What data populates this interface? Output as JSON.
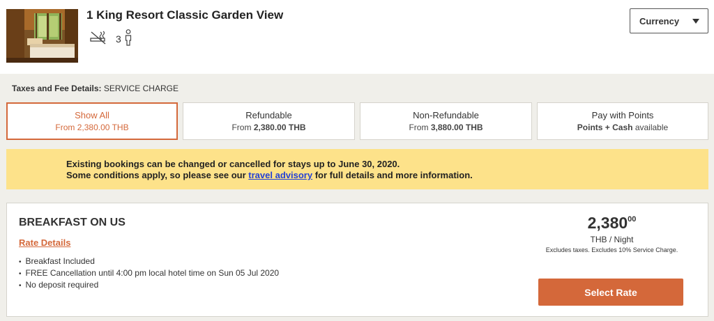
{
  "room": {
    "title": "1 King Resort Classic Garden View",
    "occupancy": "3",
    "icons": [
      "no-smoking-icon",
      "person-icon"
    ]
  },
  "currency": {
    "label": "Currency"
  },
  "taxes": {
    "label": "Taxes and Fee Details:",
    "value": "SERVICE CHARGE"
  },
  "tabs": [
    {
      "title": "Show All",
      "prefix": "From",
      "price": "2,380.00 THB",
      "active": true
    },
    {
      "title": "Refundable",
      "prefix": "From",
      "price": "2,380.00 THB"
    },
    {
      "title": "Non-Refundable",
      "prefix": "From",
      "price": "3,880.00 THB"
    },
    {
      "title": "Pay with Points",
      "price": "Points + Cash",
      "suffix": "available"
    }
  ],
  "advisory": {
    "line1_prefix": "Existing bookings can be changed or cancelled for stays up to",
    "line1_date": "June 30, 2020.",
    "line2_prefix": "Some conditions apply, so please see our",
    "link": "travel advisory",
    "line2_suffix": "for full details and more information."
  },
  "rate": {
    "name": "BREAKFAST ON US",
    "details_link": "Rate Details",
    "features": [
      "Breakfast Included",
      "FREE Cancellation until 4:00 pm local hotel time on Sun 05 Jul 2020",
      "No deposit required"
    ],
    "price_whole": "2,380",
    "price_cents": "00",
    "per_night": "THB / Night",
    "note": "Excludes taxes. Excludes 10% Service Charge.",
    "select_label": "Select Rate"
  },
  "colors": {
    "accent": "#d4683a",
    "advisory_bg": "#fde28a",
    "link": "#2340d6",
    "page_bg": "#f0efea"
  }
}
